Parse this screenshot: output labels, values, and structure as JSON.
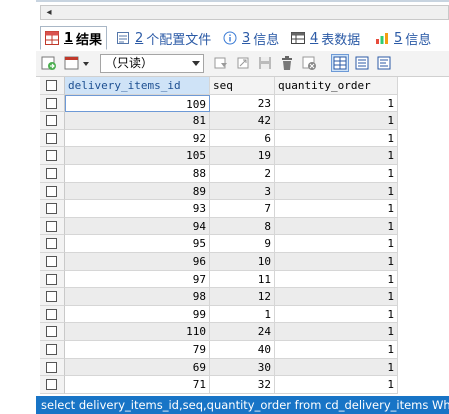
{
  "tabs": [
    {
      "num": "1",
      "label": "结果",
      "icon": "results-grid-icon",
      "active": true
    },
    {
      "num": "2",
      "label": "个配置文件",
      "icon": "profile-icon",
      "active": false
    },
    {
      "num": "3",
      "label": "信息",
      "icon": "info-icon",
      "active": false
    },
    {
      "num": "4",
      "label": "表数据",
      "icon": "table-data-icon",
      "active": false
    },
    {
      "num": "5",
      "label": "信息",
      "icon": "history-info-icon",
      "active": false
    }
  ],
  "toolbar": {
    "mode_value": "（只读）"
  },
  "grid": {
    "columns": [
      "delivery_items_id",
      "seq",
      "quantity_order"
    ],
    "rows": [
      [
        "109",
        "23",
        "1"
      ],
      [
        "81",
        "42",
        "1"
      ],
      [
        "92",
        "6",
        "1"
      ],
      [
        "105",
        "19",
        "1"
      ],
      [
        "88",
        "2",
        "1"
      ],
      [
        "89",
        "3",
        "1"
      ],
      [
        "93",
        "7",
        "1"
      ],
      [
        "94",
        "8",
        "1"
      ],
      [
        "95",
        "9",
        "1"
      ],
      [
        "96",
        "10",
        "1"
      ],
      [
        "97",
        "11",
        "1"
      ],
      [
        "98",
        "12",
        "1"
      ],
      [
        "99",
        "1",
        "1"
      ],
      [
        "110",
        "24",
        "1"
      ],
      [
        "79",
        "40",
        "1"
      ],
      [
        "69",
        "30",
        "1"
      ],
      [
        "71",
        "32",
        "1"
      ]
    ]
  },
  "status": {
    "sql": "select delivery_items_id,seq,quantity_order from cd_delivery_items Wh"
  },
  "colors": {
    "status_bg": "#1874c6",
    "tab_link": "#2b5aa6",
    "header_highlight": "#cfe3f7"
  }
}
